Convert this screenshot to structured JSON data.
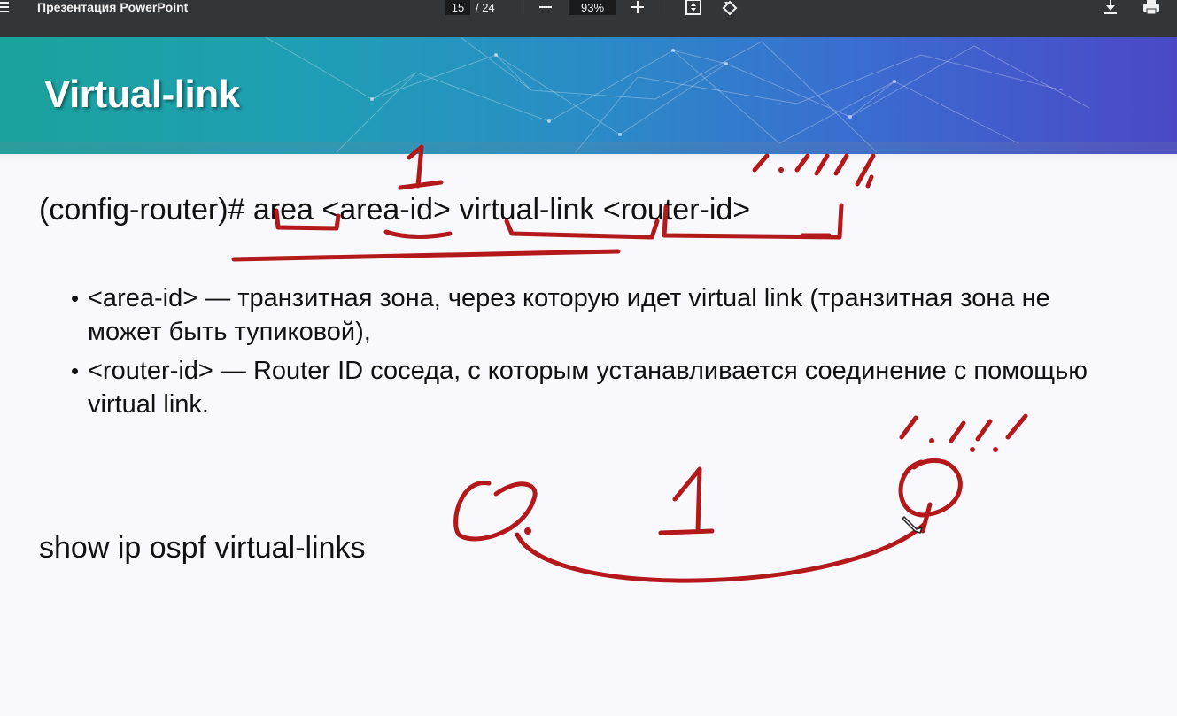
{
  "toolbar": {
    "doc_title": "Презентация PowerPoint",
    "current_page": "15",
    "page_total": "/ 24",
    "zoom": "93%",
    "icons": [
      "menu-icon",
      "zoom-out-icon",
      "zoom-in-icon",
      "fit-page-icon",
      "rotate-icon",
      "download-icon",
      "print-icon"
    ]
  },
  "slide": {
    "title": "Virtual-link",
    "command": "(config-router)# area <area-id> virtual-link <router-id>",
    "bullets": [
      "<area-id> — транзитная зона, через которую идет virtual link (транзитная зона не может быть тупиковой),",
      "<router-id> — Router ID соседа, с которым устанавливается соединение с помощью virtual link."
    ],
    "show_command": "show ip ospf virtual-links",
    "bullet_char": "•"
  },
  "annotations": {
    "ink_color": "#b3191b",
    "handwritten": [
      "1",
      "1.1.1.1",
      "1.1.1.1",
      "0",
      "1",
      "0"
    ]
  }
}
